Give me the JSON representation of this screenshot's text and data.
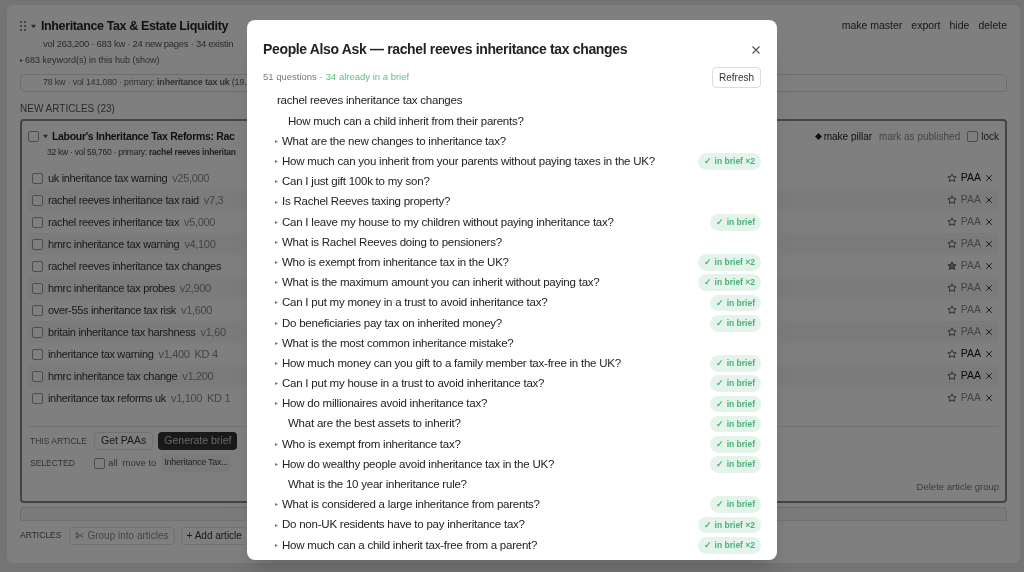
{
  "hub": {
    "title": "Inheritance Tax & Estate Liquidity",
    "stats": "vol 263,200 · 683 kw · 24 new pages · 34 existin",
    "keywords_toggle": "683 keyword(s) in this hub (show)",
    "actions": [
      "make master",
      "export",
      "hide",
      "delete"
    ],
    "summary": "78 kw · vol 141,080 · primary: **inheritance tax uk** (19,"
  },
  "new_articles_heading": "NEW ARTICLES (23)",
  "article": {
    "checked": false,
    "title": "Labour's Inheritance Tax Reforms: Rac",
    "meta": "32 kw · vol 59,760 · primary: **rachel reeves inheritan**",
    "make_pillar": "make pillar",
    "mark_published": "mark as published",
    "lock": {
      "label": "lock",
      "checked": false
    },
    "keywords": [
      {
        "keyword": "uk inheritance tax warning",
        "volume": "v25,000",
        "checked": false,
        "starred": false,
        "paa": "PAA",
        "paa_active": true
      },
      {
        "keyword": "rachel reeves inheritance tax raid",
        "volume": "v7,3",
        "checked": false,
        "starred": false,
        "paa": "PAA",
        "paa_active": false
      },
      {
        "keyword": "rachel reeves inheritance tax",
        "volume": "v5,000",
        "checked": false,
        "starred": false,
        "paa": "PAA",
        "paa_active": false
      },
      {
        "keyword": "hmrc inheritance tax warning",
        "volume": "v4,100",
        "checked": false,
        "starred": false,
        "paa": "PAA",
        "paa_active": false
      },
      {
        "keyword": "rachel reeves inheritance tax changes",
        "checked": false,
        "starred": true,
        "paa": "PAA",
        "paa_active": false
      },
      {
        "keyword": "hmrc inheritance tax probes",
        "volume": "v2,900",
        "checked": false,
        "starred": false,
        "paa": "PAA",
        "paa_active": false
      },
      {
        "keyword": "over-55s inheritance tax risk",
        "volume": "v1,600",
        "checked": false,
        "starred": false,
        "paa": "PAA",
        "paa_active": false
      },
      {
        "keyword": "britain inheritance tax harshness",
        "volume": "v1,60",
        "checked": false,
        "starred": false,
        "paa": "PAA",
        "paa_active": false
      },
      {
        "keyword": "inheritance tax warning",
        "volume": "v1,400",
        "kd": "KD 4",
        "checked": false,
        "starred": false,
        "paa": "PAA",
        "paa_active": true
      },
      {
        "keyword": "hmrc inheritance tax change",
        "volume": "v1,200",
        "checked": false,
        "starred": false,
        "paa": "PAA",
        "paa_active": true
      },
      {
        "keyword": "inheritance tax reforms uk",
        "volume": "v1,100",
        "kd": "KD 1",
        "checked": false,
        "starred": false,
        "paa": "PAA",
        "paa_active": false
      }
    ],
    "this_article_label": "THIS ARTICLE",
    "get_paas": "Get PAAs",
    "generate_brief": "Generate brief",
    "selected_label": "SELECTED",
    "all": {
      "label": "all",
      "checked": false
    },
    "move_to": "move to",
    "move_target": "Inheritance Tax...",
    "delete_group": "Delete article group"
  },
  "footer": {
    "label": "ARTICLES",
    "group": {
      "label": "Group into articles",
      "disabled": true
    },
    "add": "+ Add article"
  },
  "dialog": {
    "title": "People Also Ask — rachel reeves inheritance tax changes",
    "count": "51 questions ·",
    "in_brief_summary": "34 already in a brief",
    "refresh": "Refresh",
    "questions": [
      {
        "kind": "root",
        "text": "rachel reeves inheritance tax changes"
      },
      {
        "kind": "leaf",
        "text": "How much can a child inherit from their parents?"
      },
      {
        "kind": "expandable",
        "text": "What are the new changes to inheritance tax?"
      },
      {
        "kind": "expandable",
        "text": "How much can you inherit from your parents without paying taxes in the UK?",
        "badge": "✓ in brief ×2"
      },
      {
        "kind": "expandable",
        "text": "Can I just gift 100k to my son?"
      },
      {
        "kind": "expandable",
        "text": "Is Rachel Reeves taxing property?"
      },
      {
        "kind": "expandable",
        "text": "Can I leave my house to my children without paying inheritance tax?",
        "badge": "✓ in brief"
      },
      {
        "kind": "expandable",
        "text": "What is Rachel Reeves doing to pensioners?"
      },
      {
        "kind": "expandable",
        "text": "Who is exempt from inheritance tax in the UK?",
        "badge": "✓ in brief ×2"
      },
      {
        "kind": "expandable",
        "text": "What is the maximum amount you can inherit without paying tax?",
        "badge": "✓ in brief ×2"
      },
      {
        "kind": "expandable",
        "text": "Can I put my money in a trust to avoid inheritance tax?",
        "badge": "✓ in brief"
      },
      {
        "kind": "expandable",
        "text": "Do beneficiaries pay tax on inherited money?",
        "badge": "✓ in brief"
      },
      {
        "kind": "expandable",
        "text": "What is the most common inheritance mistake?"
      },
      {
        "kind": "expandable",
        "text": "How much money can you gift to a family member tax-free in the UK?",
        "badge": "✓ in brief"
      },
      {
        "kind": "expandable",
        "text": "Can I put my house in a trust to avoid inheritance tax?",
        "badge": "✓ in brief"
      },
      {
        "kind": "expandable",
        "text": "How do millionaires avoid inheritance tax?",
        "badge": "✓ in brief"
      },
      {
        "kind": "leaf",
        "text": "What are the best assets to inherit?",
        "badge": "✓ in brief"
      },
      {
        "kind": "expandable",
        "text": "Who is exempt from inheritance tax?",
        "badge": "✓ in brief"
      },
      {
        "kind": "expandable",
        "text": "How do wealthy people avoid inheritance tax in the UK?",
        "badge": "✓ in brief"
      },
      {
        "kind": "leaf",
        "text": "What is the 10 year inheritance rule?"
      },
      {
        "kind": "expandable",
        "text": "What is considered a large inheritance from parents?",
        "badge": "✓ in brief"
      },
      {
        "kind": "expandable",
        "text": "Do non-UK residents have to pay inheritance tax?",
        "badge": "✓ in brief ×2"
      },
      {
        "kind": "expandable",
        "text": "How much can a child inherit tax-free from a parent?",
        "badge": "✓ in brief ×2"
      }
    ]
  }
}
